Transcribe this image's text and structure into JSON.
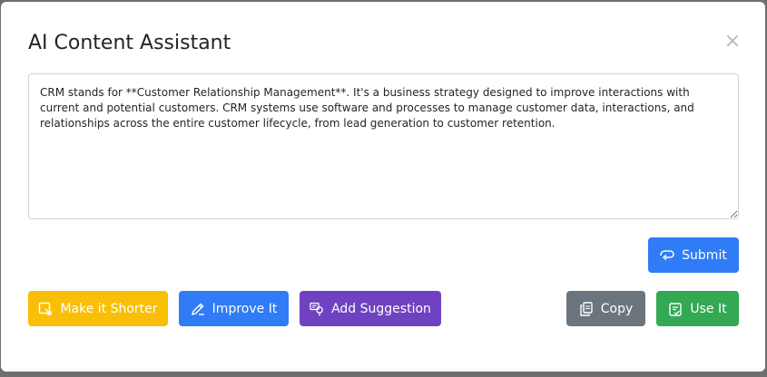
{
  "dialog": {
    "title": "AI Content Assistant",
    "close_label": "×"
  },
  "editor": {
    "text": "CRM stands for **Customer Relationship Management**.  It's a business strategy designed to improve interactions with current and potential customers.  CRM systems use software and processes to manage customer data, interactions, and relationships across the entire customer lifecycle, from lead generation to customer retention."
  },
  "buttons": {
    "submit": "Submit",
    "make_shorter": "Make it Shorter",
    "improve": "Improve It",
    "add_suggestion": "Add Suggestion",
    "copy": "Copy",
    "use_it": "Use It"
  },
  "colors": {
    "primary": "#2f7cf6",
    "warning": "#f9bf06",
    "purple": "#6f42c1",
    "secondary": "#6c757d",
    "success": "#34a853"
  },
  "icons": {
    "submit": "send-icon",
    "make_shorter": "shrink-icon",
    "improve": "edit-icon",
    "add_suggestion": "lightbulb-icon",
    "copy": "copy-icon",
    "use_it": "clipboard-check-icon",
    "close": "close-icon"
  }
}
